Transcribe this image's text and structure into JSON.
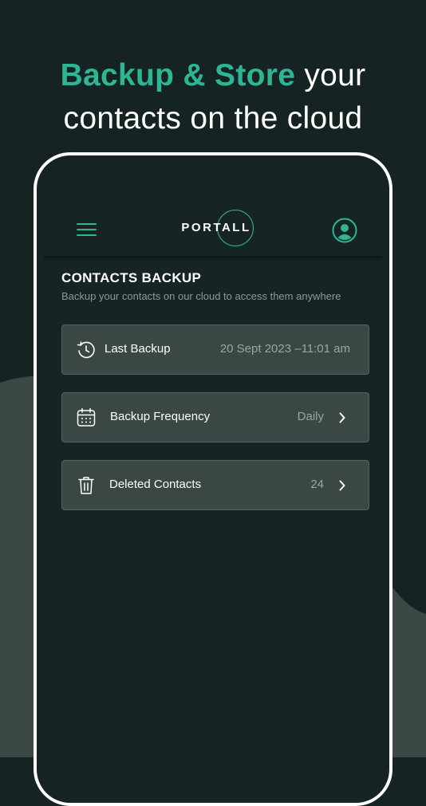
{
  "headline": {
    "accent": "Backup & Store",
    "rest": " your",
    "line2": "contacts on the cloud"
  },
  "app": {
    "logo_text": "PORTALL",
    "menu_icon": "hamburger-menu-icon",
    "profile_icon": "user-profile-icon"
  },
  "section": {
    "title": "CONTACTS BACKUP",
    "subtitle": "Backup your contacts on our cloud to access them anywhere"
  },
  "items": [
    {
      "icon": "history-clock-icon",
      "label": "Last Backup",
      "value": "20 Sept 2023 –11:01 am",
      "has_chevron": false
    },
    {
      "icon": "calendar-icon",
      "label": "Backup Frequency",
      "value": "Daily",
      "has_chevron": true
    },
    {
      "icon": "trash-icon",
      "label": "Deleted Contacts",
      "value": "24",
      "has_chevron": true
    }
  ],
  "colors": {
    "accent": "#2db594",
    "background": "#152323",
    "card": "#3a4745",
    "muted_text": "#9aa6a4"
  }
}
